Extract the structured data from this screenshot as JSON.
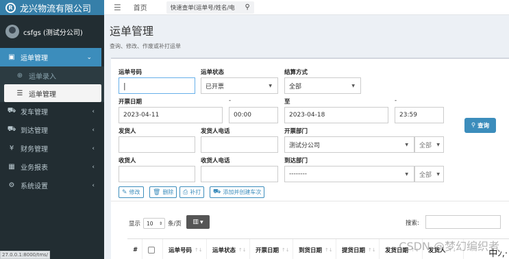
{
  "app": {
    "title": "龙兴物流有限公司",
    "logo_letter": "R"
  },
  "user": {
    "name": "csfgs (测试分公司)"
  },
  "sidebar": {
    "items": [
      {
        "label": "运单管理",
        "icon": "clipboard-icon",
        "active": true
      },
      {
        "label": "发车管理",
        "icon": "truck-icon"
      },
      {
        "label": "到达管理",
        "icon": "truck-arrive-icon"
      },
      {
        "label": "财务管理",
        "icon": "yen-icon"
      },
      {
        "label": "业务报表",
        "icon": "table-icon"
      },
      {
        "label": "系统设置",
        "icon": "gear-icon"
      }
    ],
    "sub_items": [
      {
        "label": "运单录入",
        "icon": "plus-circle-icon"
      },
      {
        "label": "运单管理",
        "icon": "list-icon",
        "current": true
      }
    ]
  },
  "status_url": "27.0.0.1:8000/tms/",
  "topbar": {
    "home": "首页",
    "search_placeholder": "快速查单(运单号/姓名/电"
  },
  "header": {
    "title": "运单管理",
    "subtitle": "查询、修改、作废或补打运单"
  },
  "form": {
    "waybill_no_label": "运单号码",
    "status_label": "运单状态",
    "status_value": "已开票",
    "settle_label": "结算方式",
    "settle_value": "全部",
    "date_label": "开票日期",
    "dash1": "-",
    "date_from": "2023-04-11",
    "time_from": "00:00",
    "to_label": "至",
    "dash2": "-",
    "date_to": "2023-04-18",
    "time_to": "23:59",
    "sender_label": "发货人",
    "sender_phone_label": "发货人电话",
    "issue_dept_label": "开票部门",
    "issue_dept_value": "测试分公司",
    "issue_dept_scope": "全部",
    "receiver_label": "收货人",
    "receiver_phone_label": "收货人电话",
    "arrive_dept_label": "到达部门",
    "arrive_dept_value": "--------",
    "arrive_dept_scope": "全部",
    "query_label": "查询"
  },
  "actions": {
    "edit": "修改",
    "delete": "删除",
    "print": "补打",
    "add_trip": "添加并创建车次"
  },
  "table": {
    "show_label": "显示",
    "page_size": "10",
    "per_page_label": "条/页",
    "search_label": "搜索:",
    "columns": [
      "#",
      "",
      "运单号码",
      "运单状态",
      "开票日期",
      "到货日期",
      "提货日期",
      "发货日期",
      "发货人"
    ]
  },
  "overlay": {
    "watermark": "CSDN @梦幻编织者",
    "corner_text": "中ﾝ,·"
  }
}
